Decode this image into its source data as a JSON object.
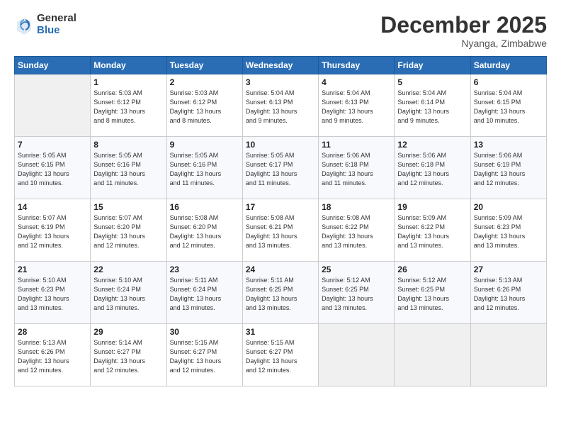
{
  "logo": {
    "general": "General",
    "blue": "Blue"
  },
  "title": "December 2025",
  "location": "Nyanga, Zimbabwe",
  "days_header": [
    "Sunday",
    "Monday",
    "Tuesday",
    "Wednesday",
    "Thursday",
    "Friday",
    "Saturday"
  ],
  "weeks": [
    [
      {
        "num": "",
        "info": ""
      },
      {
        "num": "1",
        "info": "Sunrise: 5:03 AM\nSunset: 6:12 PM\nDaylight: 13 hours\nand 8 minutes."
      },
      {
        "num": "2",
        "info": "Sunrise: 5:03 AM\nSunset: 6:12 PM\nDaylight: 13 hours\nand 8 minutes."
      },
      {
        "num": "3",
        "info": "Sunrise: 5:04 AM\nSunset: 6:13 PM\nDaylight: 13 hours\nand 9 minutes."
      },
      {
        "num": "4",
        "info": "Sunrise: 5:04 AM\nSunset: 6:13 PM\nDaylight: 13 hours\nand 9 minutes."
      },
      {
        "num": "5",
        "info": "Sunrise: 5:04 AM\nSunset: 6:14 PM\nDaylight: 13 hours\nand 9 minutes."
      },
      {
        "num": "6",
        "info": "Sunrise: 5:04 AM\nSunset: 6:15 PM\nDaylight: 13 hours\nand 10 minutes."
      }
    ],
    [
      {
        "num": "7",
        "info": "Sunrise: 5:05 AM\nSunset: 6:15 PM\nDaylight: 13 hours\nand 10 minutes."
      },
      {
        "num": "8",
        "info": "Sunrise: 5:05 AM\nSunset: 6:16 PM\nDaylight: 13 hours\nand 11 minutes."
      },
      {
        "num": "9",
        "info": "Sunrise: 5:05 AM\nSunset: 6:16 PM\nDaylight: 13 hours\nand 11 minutes."
      },
      {
        "num": "10",
        "info": "Sunrise: 5:05 AM\nSunset: 6:17 PM\nDaylight: 13 hours\nand 11 minutes."
      },
      {
        "num": "11",
        "info": "Sunrise: 5:06 AM\nSunset: 6:18 PM\nDaylight: 13 hours\nand 11 minutes."
      },
      {
        "num": "12",
        "info": "Sunrise: 5:06 AM\nSunset: 6:18 PM\nDaylight: 13 hours\nand 12 minutes."
      },
      {
        "num": "13",
        "info": "Sunrise: 5:06 AM\nSunset: 6:19 PM\nDaylight: 13 hours\nand 12 minutes."
      }
    ],
    [
      {
        "num": "14",
        "info": "Sunrise: 5:07 AM\nSunset: 6:19 PM\nDaylight: 13 hours\nand 12 minutes."
      },
      {
        "num": "15",
        "info": "Sunrise: 5:07 AM\nSunset: 6:20 PM\nDaylight: 13 hours\nand 12 minutes."
      },
      {
        "num": "16",
        "info": "Sunrise: 5:08 AM\nSunset: 6:20 PM\nDaylight: 13 hours\nand 12 minutes."
      },
      {
        "num": "17",
        "info": "Sunrise: 5:08 AM\nSunset: 6:21 PM\nDaylight: 13 hours\nand 13 minutes."
      },
      {
        "num": "18",
        "info": "Sunrise: 5:08 AM\nSunset: 6:22 PM\nDaylight: 13 hours\nand 13 minutes."
      },
      {
        "num": "19",
        "info": "Sunrise: 5:09 AM\nSunset: 6:22 PM\nDaylight: 13 hours\nand 13 minutes."
      },
      {
        "num": "20",
        "info": "Sunrise: 5:09 AM\nSunset: 6:23 PM\nDaylight: 13 hours\nand 13 minutes."
      }
    ],
    [
      {
        "num": "21",
        "info": "Sunrise: 5:10 AM\nSunset: 6:23 PM\nDaylight: 13 hours\nand 13 minutes."
      },
      {
        "num": "22",
        "info": "Sunrise: 5:10 AM\nSunset: 6:24 PM\nDaylight: 13 hours\nand 13 minutes."
      },
      {
        "num": "23",
        "info": "Sunrise: 5:11 AM\nSunset: 6:24 PM\nDaylight: 13 hours\nand 13 minutes."
      },
      {
        "num": "24",
        "info": "Sunrise: 5:11 AM\nSunset: 6:25 PM\nDaylight: 13 hours\nand 13 minutes."
      },
      {
        "num": "25",
        "info": "Sunrise: 5:12 AM\nSunset: 6:25 PM\nDaylight: 13 hours\nand 13 minutes."
      },
      {
        "num": "26",
        "info": "Sunrise: 5:12 AM\nSunset: 6:25 PM\nDaylight: 13 hours\nand 13 minutes."
      },
      {
        "num": "27",
        "info": "Sunrise: 5:13 AM\nSunset: 6:26 PM\nDaylight: 13 hours\nand 12 minutes."
      }
    ],
    [
      {
        "num": "28",
        "info": "Sunrise: 5:13 AM\nSunset: 6:26 PM\nDaylight: 13 hours\nand 12 minutes."
      },
      {
        "num": "29",
        "info": "Sunrise: 5:14 AM\nSunset: 6:27 PM\nDaylight: 13 hours\nand 12 minutes."
      },
      {
        "num": "30",
        "info": "Sunrise: 5:15 AM\nSunset: 6:27 PM\nDaylight: 13 hours\nand 12 minutes."
      },
      {
        "num": "31",
        "info": "Sunrise: 5:15 AM\nSunset: 6:27 PM\nDaylight: 13 hours\nand 12 minutes."
      },
      {
        "num": "",
        "info": ""
      },
      {
        "num": "",
        "info": ""
      },
      {
        "num": "",
        "info": ""
      }
    ]
  ]
}
